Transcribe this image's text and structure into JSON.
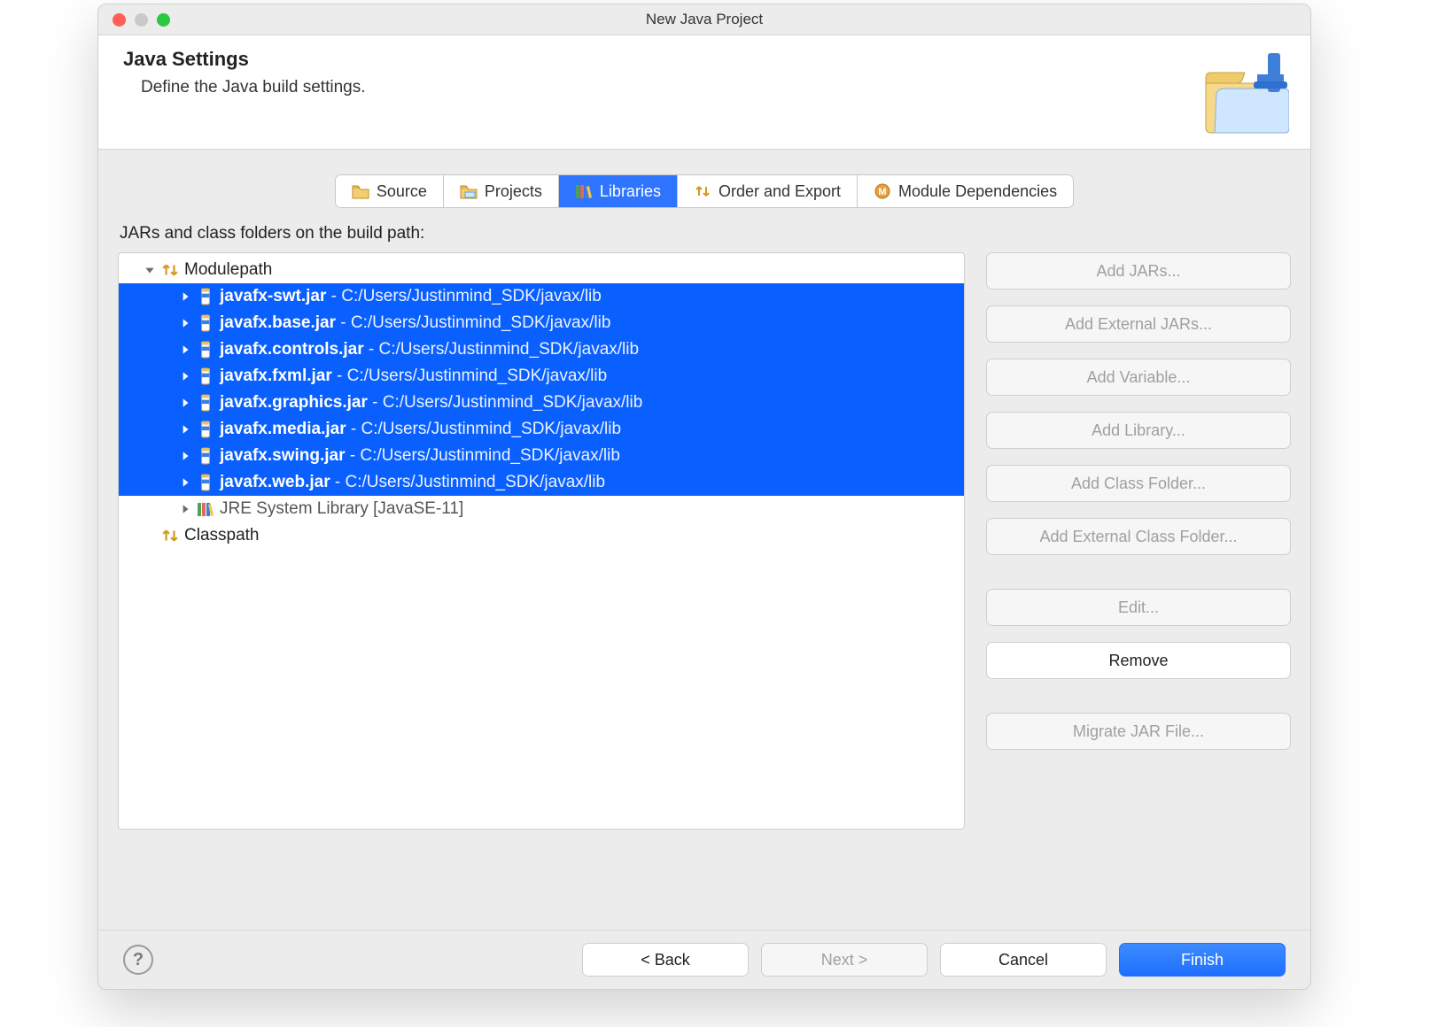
{
  "window_title": "New Java Project",
  "header_title": "Java Settings",
  "header_subtitle": "Define the Java build settings.",
  "tabs": [
    {
      "label": "Source"
    },
    {
      "label": "Projects"
    },
    {
      "label": "Libraries"
    },
    {
      "label": "Order and Export"
    },
    {
      "label": "Module Dependencies"
    }
  ],
  "subheading": "JARs and class folders on the build path:",
  "tree": {
    "modulepath_label": "Modulepath",
    "classpath_label": "Classpath",
    "jre_label": "JRE System Library [JavaSE-11]",
    "jar_path": " - C:/Users/Justinmind_SDK/javax/lib",
    "jars": [
      "javafx-swt.jar",
      "javafx.base.jar",
      "javafx.controls.jar",
      "javafx.fxml.jar",
      "javafx.graphics.jar",
      "javafx.media.jar",
      "javafx.swing.jar",
      "javafx.web.jar"
    ]
  },
  "side_buttons": {
    "add_jars": "Add JARs...",
    "add_external_jars": "Add External JARs...",
    "add_variable": "Add Variable...",
    "add_library": "Add Library...",
    "add_class_folder": "Add Class Folder...",
    "add_external_class_folder": "Add External Class Folder...",
    "edit": "Edit...",
    "remove": "Remove",
    "migrate": "Migrate JAR File..."
  },
  "footer": {
    "back": "< Back",
    "next": "Next >",
    "cancel": "Cancel",
    "finish": "Finish"
  }
}
